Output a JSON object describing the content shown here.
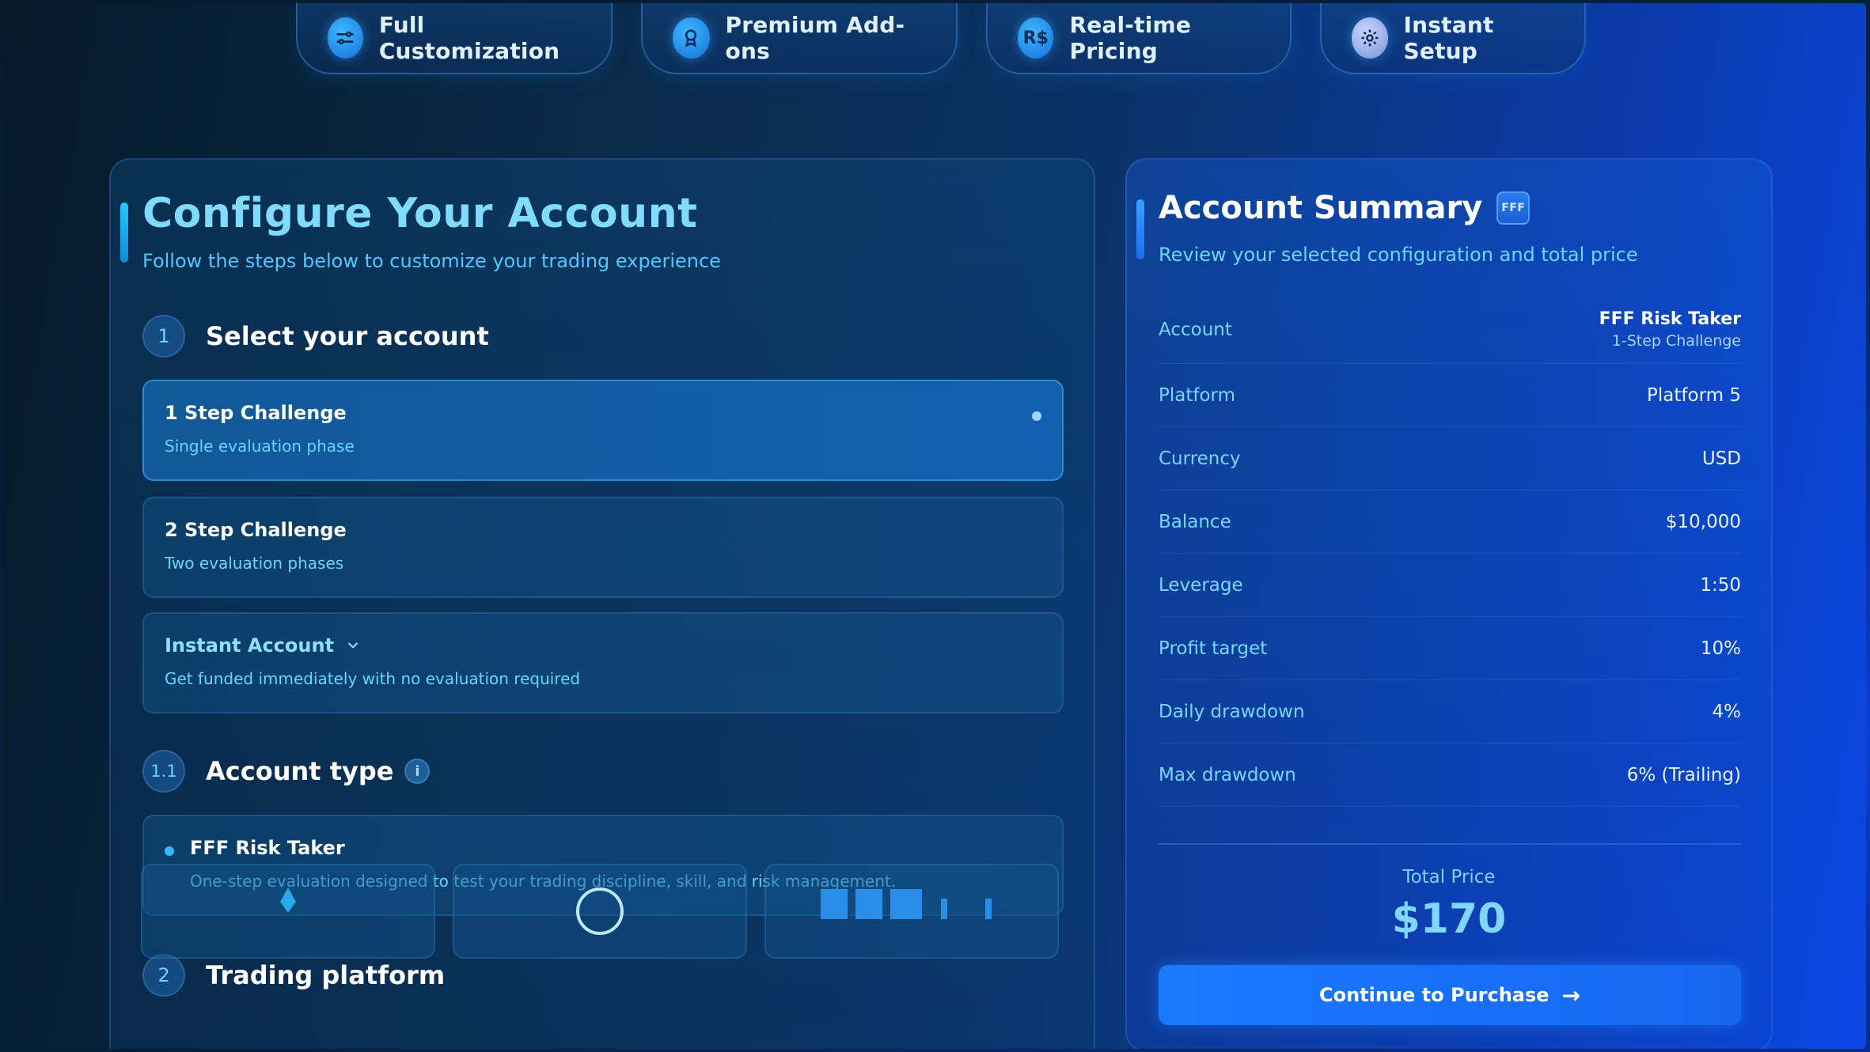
{
  "features": [
    {
      "label": "Full Customization",
      "icon": "sliders-icon"
    },
    {
      "label": "Premium Add-ons",
      "icon": "award-icon"
    },
    {
      "label": "Real-time Pricing",
      "icon": "currency-icon",
      "glyph": "R$"
    },
    {
      "label": "Instant Setup",
      "icon": "gear-icon"
    }
  ],
  "configure": {
    "title": "Configure Your Account",
    "subtitle": "Follow the steps below to customize your trading experience",
    "step1": {
      "num": "1",
      "label": "Select your account"
    },
    "accounts": [
      {
        "title": "1 Step Challenge",
        "desc": "Single evaluation phase"
      },
      {
        "title": "2 Step Challenge",
        "desc": "Two evaluation phases"
      },
      {
        "title": "Instant Account",
        "desc": "Get funded immediately with no evaluation required"
      }
    ],
    "step1_1": {
      "num": "1.1",
      "label": "Account type",
      "info": "i"
    },
    "account_type": {
      "title": "FFF Risk Taker",
      "desc": "One-step evaluation designed to test your trading discipline, skill, and risk management."
    },
    "step2": {
      "num": "2",
      "label": "Trading platform"
    }
  },
  "summary": {
    "title": "Account Summary",
    "badge": "FFF",
    "subtitle": "Review your selected configuration and total price",
    "account_label": "Account",
    "account_value": "FFF Risk Taker",
    "account_sub": "1-Step Challenge",
    "rows": [
      {
        "label": "Platform",
        "value": "Platform 5"
      },
      {
        "label": "Currency",
        "value": "USD"
      },
      {
        "label": "Balance",
        "value": "$10,000"
      },
      {
        "label": "Leverage",
        "value": "1:50"
      },
      {
        "label": "Profit target",
        "value": "10%"
      },
      {
        "label": "Daily drawdown",
        "value": "4%"
      },
      {
        "label": "Max drawdown",
        "value": "6% (Trailing)"
      }
    ],
    "total_label": "Total Price",
    "total_value": "$170",
    "cta": "Continue to Purchase",
    "cta_arrow": "→"
  }
}
